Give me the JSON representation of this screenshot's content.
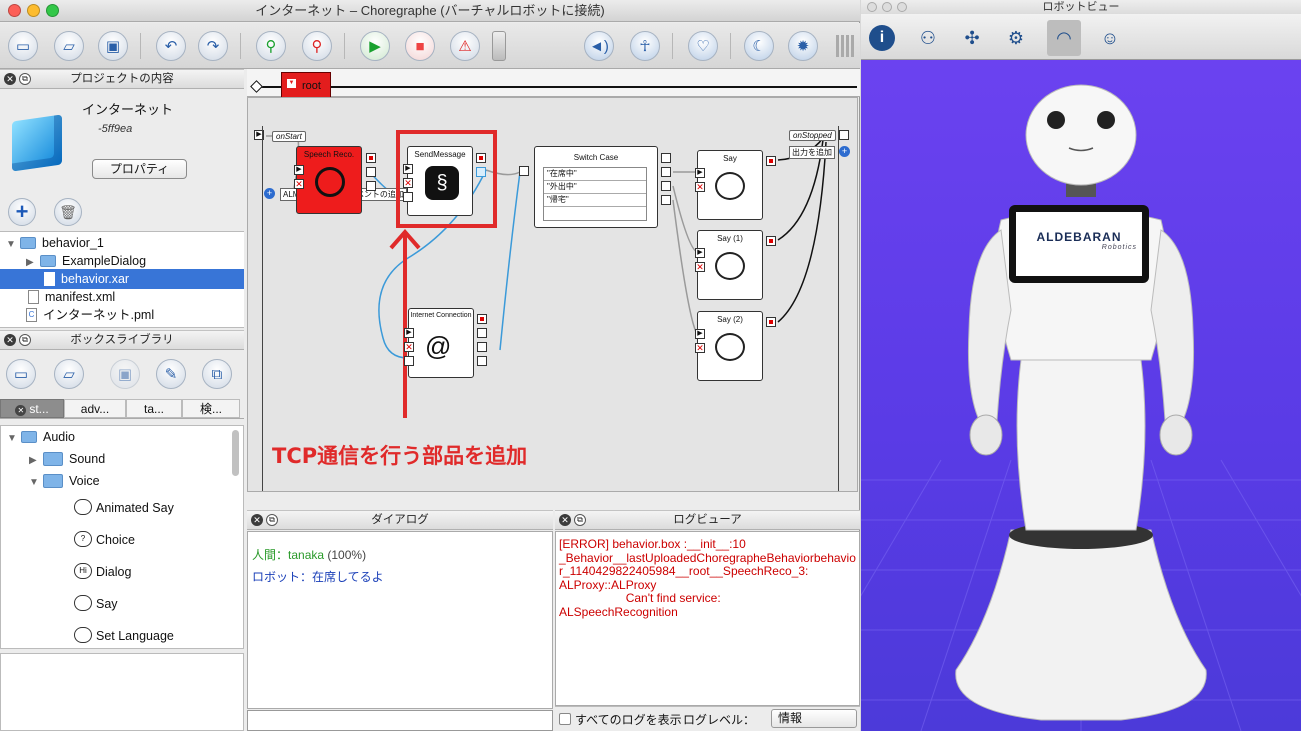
{
  "main_window": {
    "title": "インターネット – Choregraphe (バーチャルロボットに接続)"
  },
  "project_panel": {
    "header": "プロジェクトの内容",
    "project_name": "インターネット",
    "project_id": "-5ff9ea",
    "properties_button": "プロパティ",
    "tree": [
      {
        "label": "behavior_1",
        "type": "folder",
        "level": 0,
        "expanded": true
      },
      {
        "label": "ExampleDialog",
        "type": "folder",
        "level": 1,
        "expanded": false
      },
      {
        "label": "behavior.xar",
        "type": "file",
        "level": 1,
        "selected": true
      },
      {
        "label": "manifest.xml",
        "type": "file",
        "level": 0
      },
      {
        "label": "インターネット.pml",
        "type": "file",
        "level": 0
      }
    ]
  },
  "box_library": {
    "header": "ボックスライブラリ",
    "tabs": [
      "st...",
      "adv...",
      "ta...",
      "検..."
    ],
    "tree": {
      "audio": "Audio",
      "sound": "Sound",
      "voice": "Voice"
    },
    "items": [
      "Animated Say",
      "Choice",
      "Dialog",
      "Say",
      "Set Language"
    ]
  },
  "flow": {
    "root_label": "root",
    "on_start": "onStart",
    "on_stopped": "onStopped",
    "add_output": "出力を追加",
    "almemory_label": "ALMemory からのイベントの追加",
    "boxes": {
      "speech_reco": "Speech Reco.",
      "send_message": "SendMessage",
      "switch_case": "Switch Case",
      "internet_connection": "Internet Connection",
      "say": "Say",
      "say1": "Say (1)",
      "say2": "Say (2)"
    },
    "switch_cases": [
      "\"在席中\"",
      "\"外出中\"",
      "\"帰宅\"",
      ""
    ]
  },
  "annotation": {
    "text": "TCP通信を行う部品を追加",
    "color": "#e02a2a"
  },
  "dialog_panel": {
    "header": "ダイアログ",
    "human_prefix": "人間：",
    "human_name": "tanaka",
    "human_confidence": "(100%)",
    "robot_line": "ロボット：在席してるよ"
  },
  "log_panel": {
    "header": "ログビューア",
    "log_text": "[ERROR] behavior.box :__init__:10\n_Behavior__lastUploadedChoregrapheBehaviorbehavior_1140429822405984__root__SpeechReco_3:\nALProxy::ALProxy\n                    Can't find service:\nALSpeechRecognition",
    "show_all_label": "すべてのログを表示",
    "level_label": "ログレベル：",
    "level_value": "情報"
  },
  "robot_view": {
    "title": "ロボットビュー",
    "tablet_brand": "ALDEBARAN",
    "tablet_sub": "Robotics"
  },
  "colors": {
    "accent": "#3875d7",
    "error": "#cc0000",
    "speech_reco_box": "#ee1c1c",
    "robot_bg": "#5a3be6"
  }
}
